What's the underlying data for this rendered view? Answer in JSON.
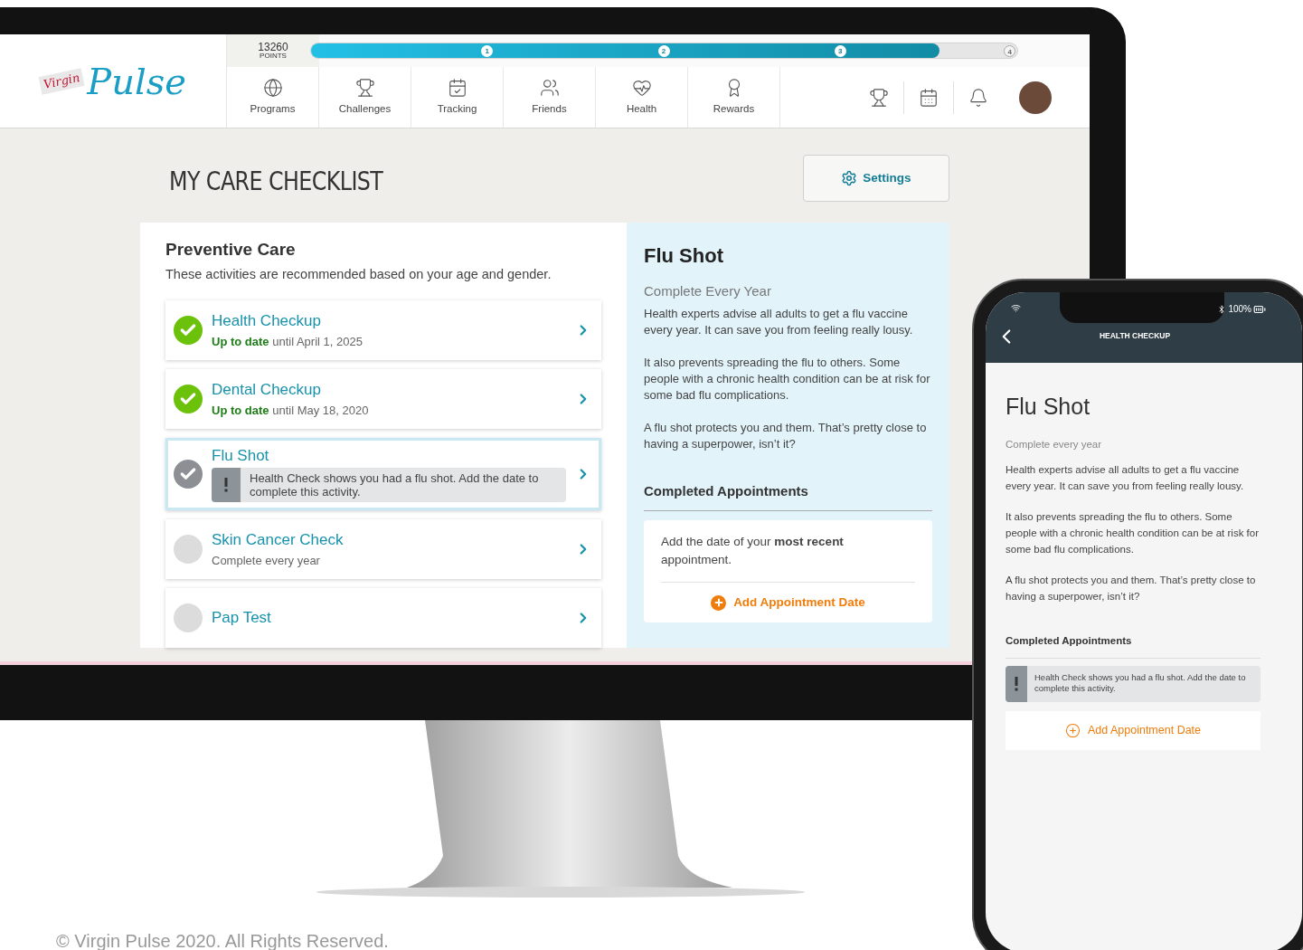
{
  "logo": {
    "script": "Virgin",
    "word": "Pulse"
  },
  "points": {
    "value": "13260",
    "label": "POINTS"
  },
  "progress": {
    "level": 0.89,
    "milestones": [
      {
        "label": "1",
        "reached": true
      },
      {
        "label": "2",
        "reached": true
      },
      {
        "label": "3",
        "reached": true
      },
      {
        "label": "4",
        "reached": false
      }
    ]
  },
  "nav": [
    {
      "label": "Programs"
    },
    {
      "label": "Challenges"
    },
    {
      "label": "Tracking"
    },
    {
      "label": "Friends"
    },
    {
      "label": "Health"
    },
    {
      "label": "Rewards"
    }
  ],
  "page_title": "MY CARE CHECKLIST",
  "settings_button": "Settings",
  "checklist": {
    "title": "Preventive Care",
    "subtitle": "These activities are recommended based on your age and gender.",
    "items": [
      {
        "title": "Health Checkup",
        "kind": "done",
        "detail": "**Up to date** until April 1, 2025",
        "selected": false
      },
      {
        "title": "Dental Checkup",
        "kind": "done",
        "detail": "**Up to date** until May 18, 2020",
        "selected": false
      },
      {
        "title": "Flu Shot",
        "kind": "attention",
        "alert": "Health Check shows you had a flu shot. Add the date to complete this activity.",
        "selected": true
      },
      {
        "title": "Skin Cancer Check",
        "kind": "todo",
        "detail": "Complete every year",
        "selected": false
      },
      {
        "title": "Pap Test",
        "kind": "todo",
        "selected": false
      }
    ]
  },
  "detail": {
    "title": "Flu Shot",
    "frequency": "Complete Every Year",
    "paragraphs": [
      "Health experts advise all adults to get a flu vaccine every year. It can save you from feeling really lousy.",
      "It also prevents spreading the flu to others. Some people with a chronic health condition can be at risk for some bad flu complications.",
      "A flu shot protects you and them. That’s pretty close to having a superpower, isn’t it?"
    ],
    "section_title": "Completed Appointments",
    "prompt": "Add the date of your **most recent** appointment.",
    "add_button": "Add Appointment Date"
  },
  "phone": {
    "battery": "100%",
    "header": "HEALTH CHECKUP",
    "title": "Flu Shot",
    "frequency": "Complete every year",
    "paragraphs": [
      "Health experts advise all adults to get a flu vaccine every year. It can save you from feeling really lousy.",
      "It also prevents spreading the flu to others. Some people with a chronic health condition can be at risk for some bad flu complications.",
      "A flu shot protects you and them. That’s pretty close to having a superpower, isn’t it?"
    ],
    "section_title": "Completed Appointments",
    "alert": "Health Check shows you had a flu shot. Add the date to complete this activity.",
    "add_button": "Add Appointment Date"
  },
  "copyright": "© Virgin Pulse 2020. All Rights Reserved."
}
